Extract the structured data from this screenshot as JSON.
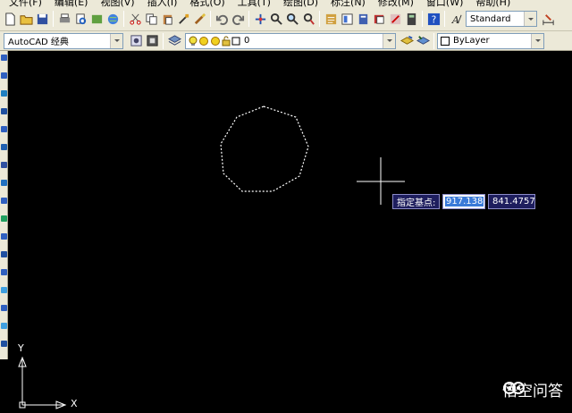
{
  "menu": {
    "items": [
      "文件(F)",
      "编辑(E)",
      "视图(V)",
      "插入(I)",
      "格式(O)",
      "工具(T)",
      "绘图(D)",
      "标注(N)",
      "修改(M)",
      "窗口(W)",
      "帮助(H)"
    ]
  },
  "toolbar1": {
    "text_style": "Standard"
  },
  "toolbar2": {
    "workspace": "AutoCAD 经典",
    "layer": "0",
    "color": "ByLayer"
  },
  "dynamic_input": {
    "prompt": "指定基点:",
    "x_value": "917.138",
    "y_value": "841.4757"
  },
  "ucs": {
    "x_label": "X",
    "y_label": "Y"
  },
  "watermark": {
    "text": "悟空问答"
  },
  "colors": {
    "background": "#000000",
    "toolbar": "#ece9d8",
    "selection": "#3a7ad8",
    "tooltip": "#1e1e5e"
  }
}
